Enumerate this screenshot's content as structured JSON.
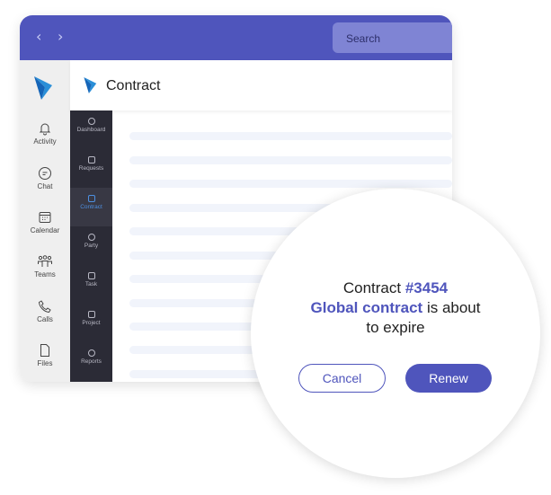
{
  "header": {
    "back_icon": "chevron-left",
    "forward_icon": "chevron-right",
    "search_placeholder": "Search",
    "accent": "#4f55bc"
  },
  "rail": [
    {
      "label": "Activity",
      "icon": "bell"
    },
    {
      "label": "Chat",
      "icon": "chat"
    },
    {
      "label": "Calendar",
      "icon": "calendar"
    },
    {
      "label": "Teams",
      "icon": "teams"
    },
    {
      "label": "Calls",
      "icon": "phone"
    },
    {
      "label": "Files",
      "icon": "file"
    }
  ],
  "page": {
    "title": "Contract"
  },
  "subnav": [
    {
      "label": "Dashboard"
    },
    {
      "label": "Requests"
    },
    {
      "label": "Contract",
      "active": true
    },
    {
      "label": "Party"
    },
    {
      "label": "Task"
    },
    {
      "label": "Project"
    },
    {
      "label": "Reports"
    }
  ],
  "dialog": {
    "prefix": "Contract",
    "number": "#3454",
    "name": "Global contract",
    "suffix1": "is about",
    "suffix2": "to expire",
    "cancel": "Cancel",
    "renew": "Renew"
  }
}
